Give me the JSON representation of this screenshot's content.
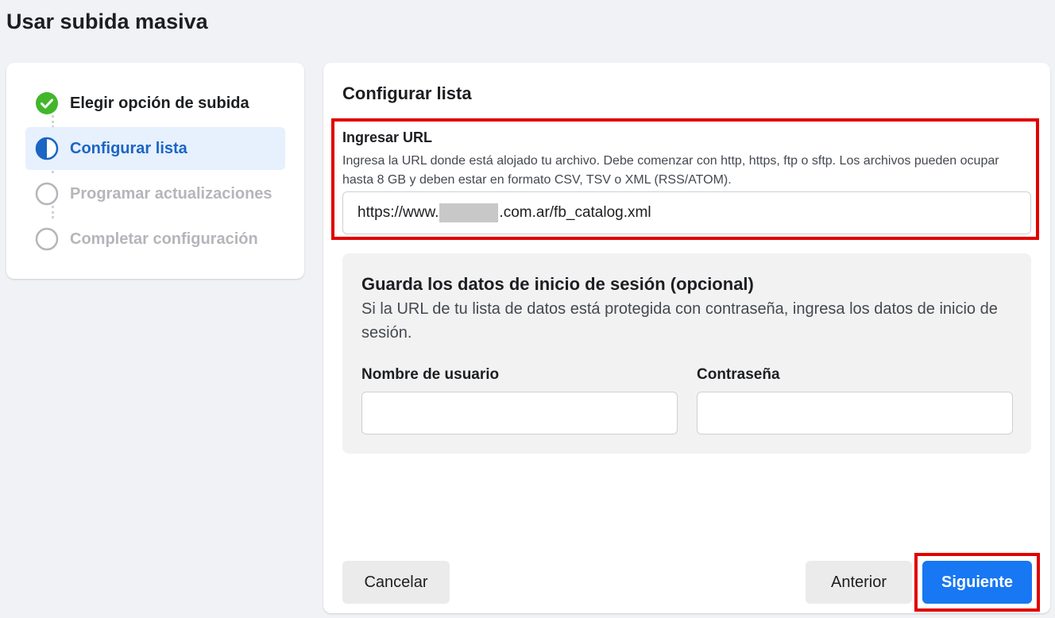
{
  "page_title": "Usar subida masiva",
  "steps": [
    {
      "label": "Elegir opción de subida",
      "state": "done"
    },
    {
      "label": "Configurar lista",
      "state": "active"
    },
    {
      "label": "Programar actualizaciones",
      "state": "pending"
    },
    {
      "label": "Completar configuración",
      "state": "pending"
    }
  ],
  "main": {
    "section_title": "Configurar lista",
    "url": {
      "label": "Ingresar URL",
      "help": "Ingresa la URL donde está alojado tu archivo. Debe comenzar con http, https, ftp o sftp. Los archivos pueden ocupar hasta 8 GB y deben estar en formato CSV, TSV o XML (RSS/ATOM).",
      "value_prefix": "https://www.",
      "value_suffix": ".com.ar/fb_catalog.xml"
    },
    "login": {
      "title": "Guarda los datos de inicio de sesión (opcional)",
      "description": "Si la URL de tu lista de datos está protegida con contraseña, ingresa los datos de inicio de sesión.",
      "username_label": "Nombre de usuario",
      "password_label": "Contraseña"
    },
    "buttons": {
      "cancel": "Cancelar",
      "previous": "Anterior",
      "next": "Siguiente"
    }
  },
  "colors": {
    "accent": "#1877f2",
    "active_step_text": "#1b65c4",
    "active_step_bg": "#e7f0fd",
    "done_green": "#42b72a",
    "highlight_red": "#e00000"
  }
}
